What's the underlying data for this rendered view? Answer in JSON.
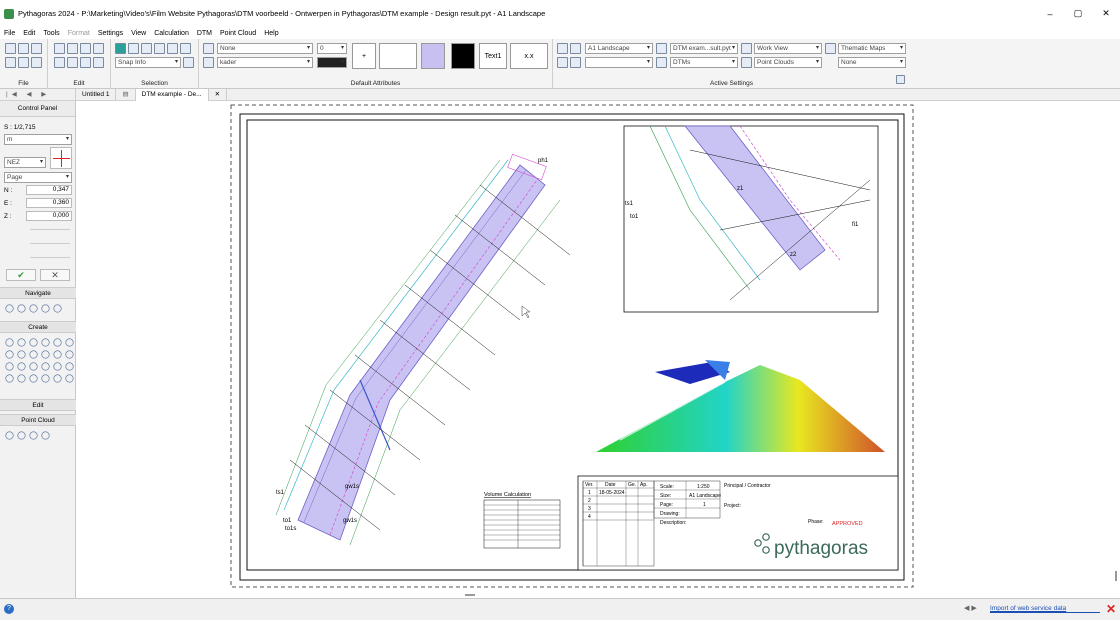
{
  "window": {
    "title": "Pythagoras 2024 - P:\\Marketing\\Video's\\Film Website Pythagoras\\DTM voorbeeld - Ontwerpen in Pythagoras\\DTM example - Design result.pyt - A1 Landscape",
    "minimize": "–",
    "restore": "▢",
    "close": "✕"
  },
  "menu": [
    "File",
    "Edit",
    "Tools",
    "Format",
    "Settings",
    "View",
    "Calculation",
    "DTM",
    "Point Cloud",
    "Help"
  ],
  "ribbon": {
    "groups": {
      "file": "File",
      "edit": "Edit",
      "selection": "Selection",
      "default_attributes": "Default Attributes",
      "active_settings": "Active Settings"
    },
    "snap": "Snap Info",
    "line_style": "None",
    "layer": "kader",
    "line_width": "0",
    "text_sample": "Text1",
    "number_sample": "x.x",
    "plus": "+",
    "layout": "A1 Landscape",
    "dtm": "DTM exam...sult.pyt",
    "view": "Work View",
    "thematic": "Thematic Maps",
    "dtms": "DTMs",
    "point_clouds": "Point Clouds",
    "thematic_none": "None"
  },
  "tabs": [
    {
      "label": "Untitled 1"
    },
    {
      "label": "DTM example - De..."
    }
  ],
  "tab_close": "✕",
  "control_panel": {
    "title": "Control Panel",
    "scale": "S : 1/2,715",
    "unit": "m",
    "coord_system": "NEZ",
    "page": "Page",
    "n_label": "N :",
    "n_value": "0,347",
    "e_label": "E :",
    "e_value": "0,360",
    "z_label": "Z :",
    "z_value": "0,000",
    "sections": {
      "navigate": "Navigate",
      "create": "Create",
      "edit": "Edit",
      "point_cloud": "Point Cloud"
    }
  },
  "drawing": {
    "labels": [
      "ph1",
      "gw1s",
      "to1",
      "ts1",
      "to1s",
      "gw1s",
      "to1",
      "ts1",
      "fi1",
      "z1",
      "z2"
    ],
    "calc_table": {
      "title": "Volume Calculation",
      "rows": [
        [
          "",
          ""
        ],
        [
          "",
          ""
        ],
        [
          "",
          ""
        ],
        [
          "",
          ""
        ],
        [
          "",
          ""
        ],
        [
          "",
          ""
        ],
        [
          "",
          ""
        ],
        [
          "",
          ""
        ],
        [
          "",
          ""
        ],
        [
          "",
          ""
        ]
      ]
    },
    "title_block": {
      "headers": [
        "Ver.",
        "Date",
        "Ge.",
        "Ap."
      ],
      "rows": [
        [
          "1",
          "18-05-2024",
          "",
          ""
        ],
        [
          "2",
          "",
          "",
          ""
        ],
        [
          "3",
          "",
          "",
          ""
        ],
        [
          "4",
          "",
          "",
          ""
        ]
      ],
      "scale_label": "Scale:",
      "scale_value": "1:250",
      "size_label": "Size:",
      "size_value": "A1 Landscape",
      "page_label": "Page:",
      "page_value": "1",
      "drawing_label": "Drawing:",
      "description_label": "Description:",
      "principal": "Principal / Contractor",
      "project": "Project:",
      "phase_label": "Phase:",
      "status": "APPROVED",
      "brand": "pythagoras"
    }
  },
  "status": {
    "help": "?",
    "nav": "◀ ▶",
    "link": "Import of web service data",
    "close": "✕"
  }
}
